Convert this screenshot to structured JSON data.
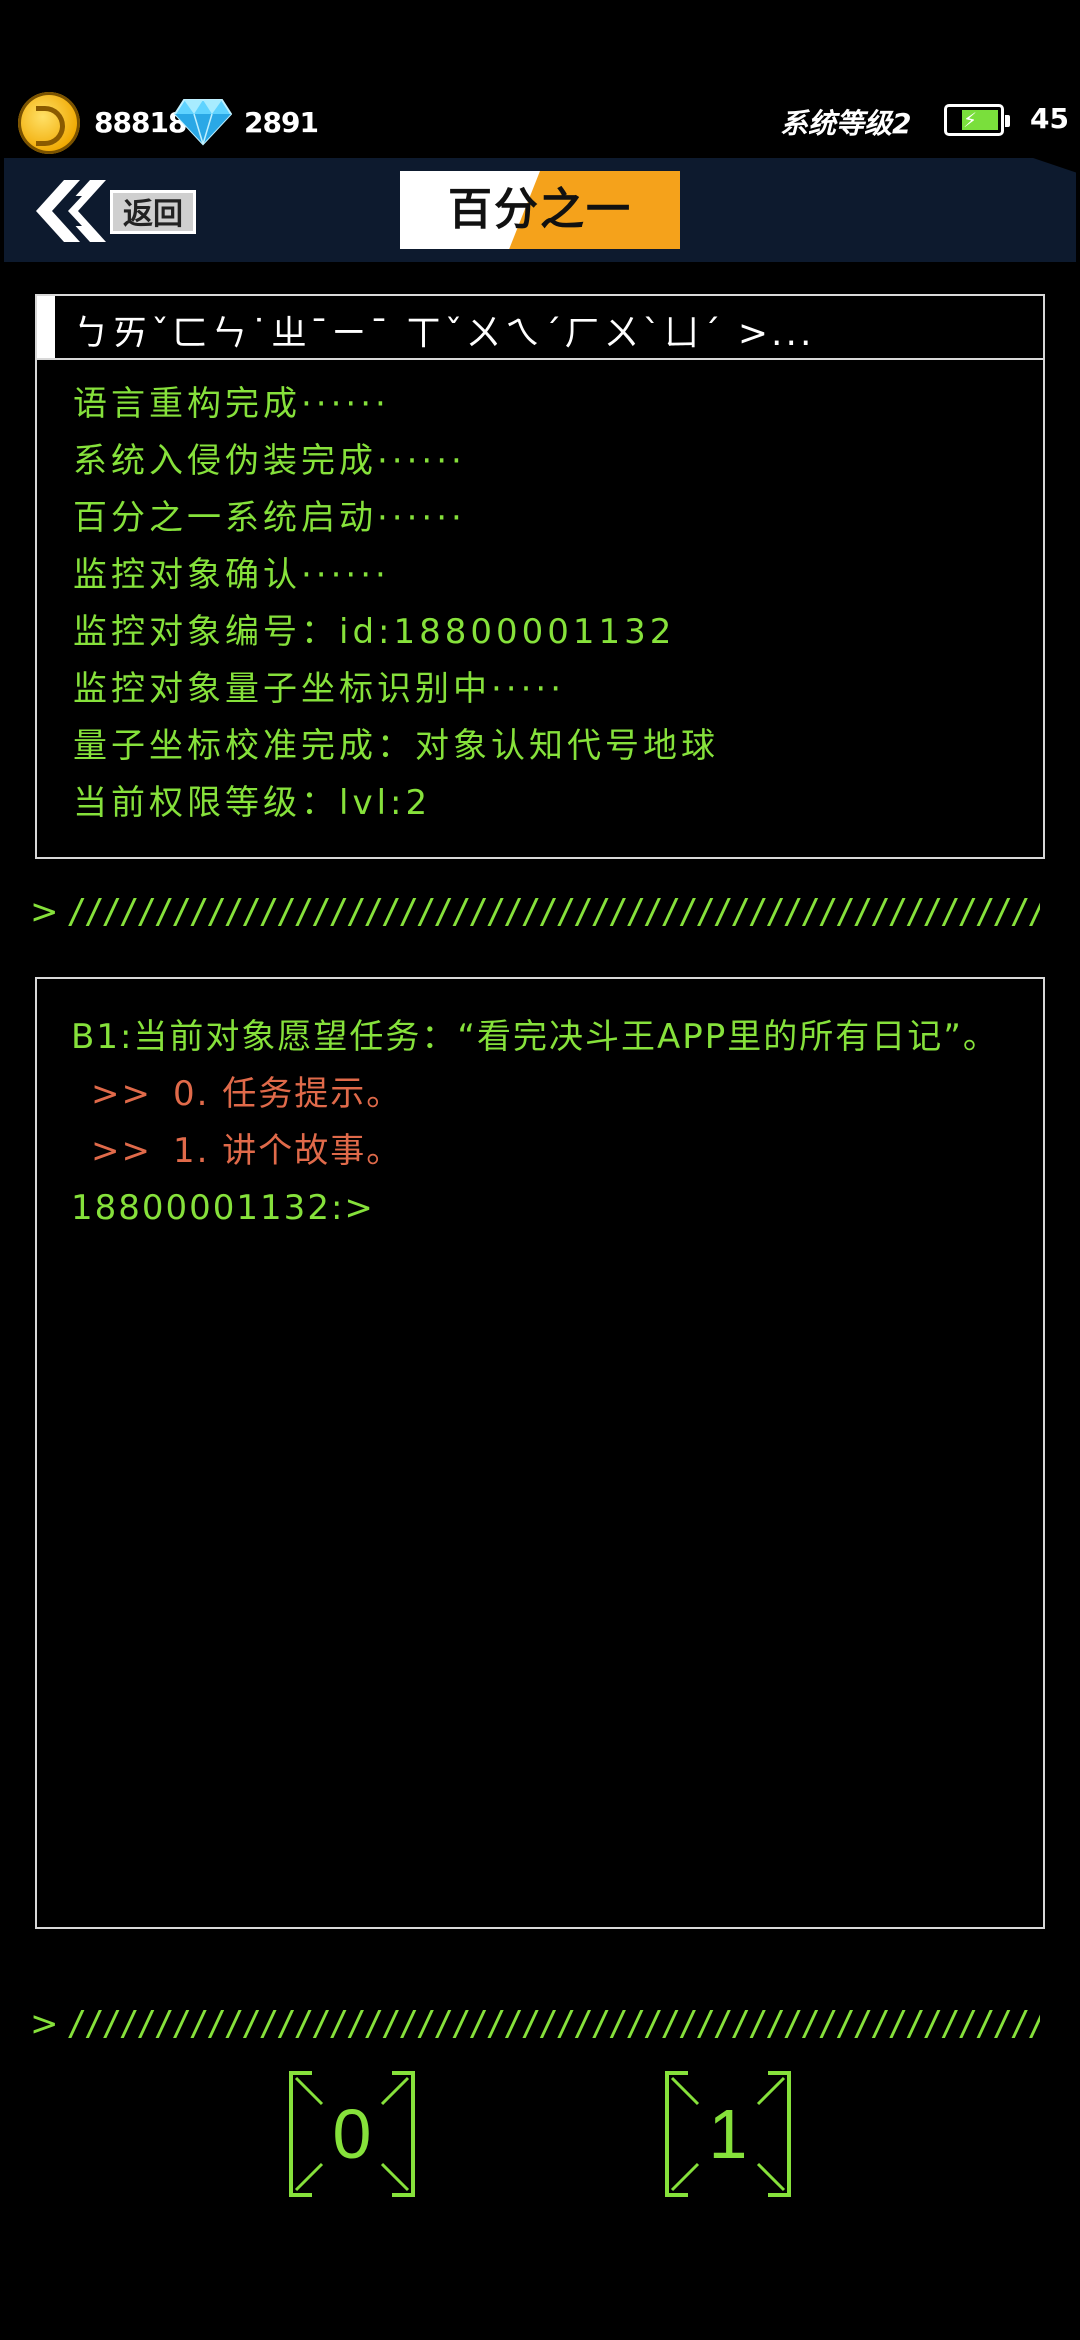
{
  "status": {
    "coins": "88818",
    "gems": "2891",
    "system_level": "系统等级2",
    "energy": "45",
    "battery_level": 0.75
  },
  "header": {
    "back_label": "返回",
    "title": "百分之一"
  },
  "info_panel": {
    "heading": "ㄅㄞˇㄈㄣ˙ㄓ¯ㄧ¯ ㄒˇㄨㄟˊㄏㄨˋㄩˊ >...",
    "lines": [
      "语言重构完成······",
      "系统入侵伪装完成······",
      "百分之一系统启动······",
      "监控对象确认······",
      "监控对象编号：id:18800001132",
      "监控对象量子坐标识别中·····",
      "量子坐标校准完成：对象认知代号地球",
      "当前权限等级：lvl:2"
    ]
  },
  "divider": {
    "chevron": ">",
    "pattern": "////////////////////////////////////////////////////////////////////////////////////"
  },
  "terminal": {
    "task": "B1:当前对象愿望任务：“看完决斗王APP里的所有日记”。",
    "options": [
      {
        "arrow": ">>",
        "text": "0. 任务提示。"
      },
      {
        "arrow": ">>",
        "text": "1. 讲个故事。"
      }
    ],
    "prompt": "18800001132:>"
  },
  "answers": {
    "option0": "0",
    "option1": "1"
  },
  "colors": {
    "accent_green": "#86e13b",
    "option_red": "#e06a4a",
    "title_orange": "#f5a21b",
    "header_bg": "#0d1a2e"
  },
  "icons": [
    "coin-icon",
    "diamond-icon",
    "battery-icon",
    "back-chevron-icon"
  ]
}
